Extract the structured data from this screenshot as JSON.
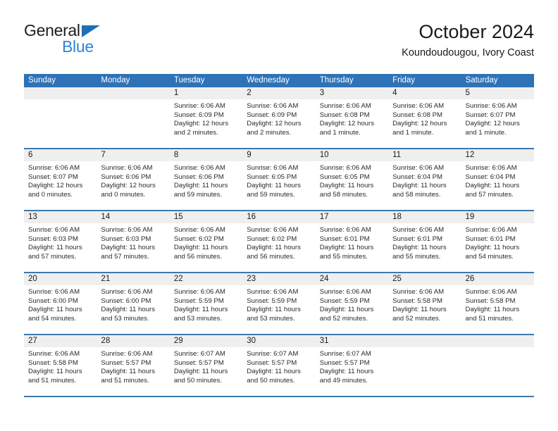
{
  "brand": {
    "name_top": "General",
    "name_bottom": "Blue",
    "triangle_color": "#1e6fb8",
    "blue_color": "#2e86d6"
  },
  "header": {
    "title": "October 2024",
    "subtitle": "Koundoudougou, Ivory Coast"
  },
  "colors": {
    "header_blue": "#2e72b8",
    "row_separator": "#3c79b0",
    "daynum_band": "#efefef"
  },
  "weekdays": [
    "Sunday",
    "Monday",
    "Tuesday",
    "Wednesday",
    "Thursday",
    "Friday",
    "Saturday"
  ],
  "weeks": [
    [
      {
        "day": "",
        "sunrise": "",
        "sunset": "",
        "daylight1": "",
        "daylight2": ""
      },
      {
        "day": "",
        "sunrise": "",
        "sunset": "",
        "daylight1": "",
        "daylight2": ""
      },
      {
        "day": "1",
        "sunrise": "Sunrise: 6:06 AM",
        "sunset": "Sunset: 6:09 PM",
        "daylight1": "Daylight: 12 hours",
        "daylight2": "and 2 minutes."
      },
      {
        "day": "2",
        "sunrise": "Sunrise: 6:06 AM",
        "sunset": "Sunset: 6:09 PM",
        "daylight1": "Daylight: 12 hours",
        "daylight2": "and 2 minutes."
      },
      {
        "day": "3",
        "sunrise": "Sunrise: 6:06 AM",
        "sunset": "Sunset: 6:08 PM",
        "daylight1": "Daylight: 12 hours",
        "daylight2": "and 1 minute."
      },
      {
        "day": "4",
        "sunrise": "Sunrise: 6:06 AM",
        "sunset": "Sunset: 6:08 PM",
        "daylight1": "Daylight: 12 hours",
        "daylight2": "and 1 minute."
      },
      {
        "day": "5",
        "sunrise": "Sunrise: 6:06 AM",
        "sunset": "Sunset: 6:07 PM",
        "daylight1": "Daylight: 12 hours",
        "daylight2": "and 1 minute."
      }
    ],
    [
      {
        "day": "6",
        "sunrise": "Sunrise: 6:06 AM",
        "sunset": "Sunset: 6:07 PM",
        "daylight1": "Daylight: 12 hours",
        "daylight2": "and 0 minutes."
      },
      {
        "day": "7",
        "sunrise": "Sunrise: 6:06 AM",
        "sunset": "Sunset: 6:06 PM",
        "daylight1": "Daylight: 12 hours",
        "daylight2": "and 0 minutes."
      },
      {
        "day": "8",
        "sunrise": "Sunrise: 6:06 AM",
        "sunset": "Sunset: 6:06 PM",
        "daylight1": "Daylight: 11 hours",
        "daylight2": "and 59 minutes."
      },
      {
        "day": "9",
        "sunrise": "Sunrise: 6:06 AM",
        "sunset": "Sunset: 6:05 PM",
        "daylight1": "Daylight: 11 hours",
        "daylight2": "and 59 minutes."
      },
      {
        "day": "10",
        "sunrise": "Sunrise: 6:06 AM",
        "sunset": "Sunset: 6:05 PM",
        "daylight1": "Daylight: 11 hours",
        "daylight2": "and 58 minutes."
      },
      {
        "day": "11",
        "sunrise": "Sunrise: 6:06 AM",
        "sunset": "Sunset: 6:04 PM",
        "daylight1": "Daylight: 11 hours",
        "daylight2": "and 58 minutes."
      },
      {
        "day": "12",
        "sunrise": "Sunrise: 6:06 AM",
        "sunset": "Sunset: 6:04 PM",
        "daylight1": "Daylight: 11 hours",
        "daylight2": "and 57 minutes."
      }
    ],
    [
      {
        "day": "13",
        "sunrise": "Sunrise: 6:06 AM",
        "sunset": "Sunset: 6:03 PM",
        "daylight1": "Daylight: 11 hours",
        "daylight2": "and 57 minutes."
      },
      {
        "day": "14",
        "sunrise": "Sunrise: 6:06 AM",
        "sunset": "Sunset: 6:03 PM",
        "daylight1": "Daylight: 11 hours",
        "daylight2": "and 57 minutes."
      },
      {
        "day": "15",
        "sunrise": "Sunrise: 6:06 AM",
        "sunset": "Sunset: 6:02 PM",
        "daylight1": "Daylight: 11 hours",
        "daylight2": "and 56 minutes."
      },
      {
        "day": "16",
        "sunrise": "Sunrise: 6:06 AM",
        "sunset": "Sunset: 6:02 PM",
        "daylight1": "Daylight: 11 hours",
        "daylight2": "and 56 minutes."
      },
      {
        "day": "17",
        "sunrise": "Sunrise: 6:06 AM",
        "sunset": "Sunset: 6:01 PM",
        "daylight1": "Daylight: 11 hours",
        "daylight2": "and 55 minutes."
      },
      {
        "day": "18",
        "sunrise": "Sunrise: 6:06 AM",
        "sunset": "Sunset: 6:01 PM",
        "daylight1": "Daylight: 11 hours",
        "daylight2": "and 55 minutes."
      },
      {
        "day": "19",
        "sunrise": "Sunrise: 6:06 AM",
        "sunset": "Sunset: 6:01 PM",
        "daylight1": "Daylight: 11 hours",
        "daylight2": "and 54 minutes."
      }
    ],
    [
      {
        "day": "20",
        "sunrise": "Sunrise: 6:06 AM",
        "sunset": "Sunset: 6:00 PM",
        "daylight1": "Daylight: 11 hours",
        "daylight2": "and 54 minutes."
      },
      {
        "day": "21",
        "sunrise": "Sunrise: 6:06 AM",
        "sunset": "Sunset: 6:00 PM",
        "daylight1": "Daylight: 11 hours",
        "daylight2": "and 53 minutes."
      },
      {
        "day": "22",
        "sunrise": "Sunrise: 6:06 AM",
        "sunset": "Sunset: 5:59 PM",
        "daylight1": "Daylight: 11 hours",
        "daylight2": "and 53 minutes."
      },
      {
        "day": "23",
        "sunrise": "Sunrise: 6:06 AM",
        "sunset": "Sunset: 5:59 PM",
        "daylight1": "Daylight: 11 hours",
        "daylight2": "and 53 minutes."
      },
      {
        "day": "24",
        "sunrise": "Sunrise: 6:06 AM",
        "sunset": "Sunset: 5:59 PM",
        "daylight1": "Daylight: 11 hours",
        "daylight2": "and 52 minutes."
      },
      {
        "day": "25",
        "sunrise": "Sunrise: 6:06 AM",
        "sunset": "Sunset: 5:58 PM",
        "daylight1": "Daylight: 11 hours",
        "daylight2": "and 52 minutes."
      },
      {
        "day": "26",
        "sunrise": "Sunrise: 6:06 AM",
        "sunset": "Sunset: 5:58 PM",
        "daylight1": "Daylight: 11 hours",
        "daylight2": "and 51 minutes."
      }
    ],
    [
      {
        "day": "27",
        "sunrise": "Sunrise: 6:06 AM",
        "sunset": "Sunset: 5:58 PM",
        "daylight1": "Daylight: 11 hours",
        "daylight2": "and 51 minutes."
      },
      {
        "day": "28",
        "sunrise": "Sunrise: 6:06 AM",
        "sunset": "Sunset: 5:57 PM",
        "daylight1": "Daylight: 11 hours",
        "daylight2": "and 51 minutes."
      },
      {
        "day": "29",
        "sunrise": "Sunrise: 6:07 AM",
        "sunset": "Sunset: 5:57 PM",
        "daylight1": "Daylight: 11 hours",
        "daylight2": "and 50 minutes."
      },
      {
        "day": "30",
        "sunrise": "Sunrise: 6:07 AM",
        "sunset": "Sunset: 5:57 PM",
        "daylight1": "Daylight: 11 hours",
        "daylight2": "and 50 minutes."
      },
      {
        "day": "31",
        "sunrise": "Sunrise: 6:07 AM",
        "sunset": "Sunset: 5:57 PM",
        "daylight1": "Daylight: 11 hours",
        "daylight2": "and 49 minutes."
      },
      {
        "day": "",
        "sunrise": "",
        "sunset": "",
        "daylight1": "",
        "daylight2": ""
      },
      {
        "day": "",
        "sunrise": "",
        "sunset": "",
        "daylight1": "",
        "daylight2": ""
      }
    ]
  ]
}
